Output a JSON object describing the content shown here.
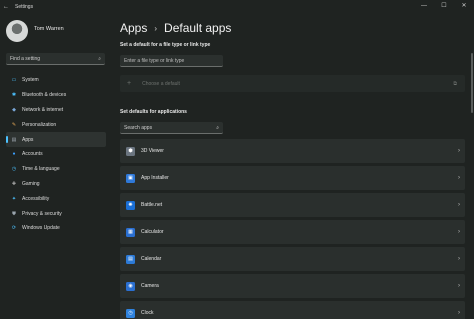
{
  "window": {
    "title": "Settings",
    "back_glyph": "←",
    "controls": {
      "minimize": "—",
      "maximize": "☐",
      "close": "✕"
    }
  },
  "sidebar": {
    "user_name": "Tom Warren",
    "find_placeholder": "Find a setting",
    "items": [
      {
        "label": "System",
        "icon": "display-icon",
        "glyph": "▭",
        "color": "#4cc2ff"
      },
      {
        "label": "Bluetooth & devices",
        "icon": "bluetooth-icon",
        "glyph": "✱",
        "color": "#4cc2ff"
      },
      {
        "label": "Network & internet",
        "icon": "network-icon",
        "glyph": "◆",
        "color": "#7aa7d8"
      },
      {
        "label": "Personalization",
        "icon": "brush-icon",
        "glyph": "✎",
        "color": "#e3a857"
      },
      {
        "label": "Apps",
        "icon": "apps-icon",
        "glyph": "▤",
        "color": "#9aa4ad",
        "active": true
      },
      {
        "label": "Accounts",
        "icon": "person-icon",
        "glyph": "●",
        "color": "#3aa0ff"
      },
      {
        "label": "Time & language",
        "icon": "clock-globe-icon",
        "glyph": "◷",
        "color": "#4cc2ff"
      },
      {
        "label": "Gaming",
        "icon": "gamepad-icon",
        "glyph": "✚",
        "color": "#b7b7b7"
      },
      {
        "label": "Accessibility",
        "icon": "accessibility-icon",
        "glyph": "✦",
        "color": "#4cc2ff"
      },
      {
        "label": "Privacy & security",
        "icon": "shield-icon",
        "glyph": "⛊",
        "color": "#9aa4ad"
      },
      {
        "label": "Windows Update",
        "icon": "update-icon",
        "glyph": "⟳",
        "color": "#4cc2ff"
      }
    ]
  },
  "main": {
    "breadcrumb": {
      "parent": "Apps",
      "separator": "›",
      "current": "Default apps"
    },
    "filetype_heading": "Set a default for a file type or link type",
    "filetype_placeholder": "Enter a file type or link type",
    "choose_default": {
      "plus": "+",
      "label": "Choose a default",
      "ext": "⧉"
    },
    "apps_heading": "Set defaults for applications",
    "search_apps_placeholder": "Search apps",
    "chevron": "›",
    "apps": [
      {
        "name": "3D Viewer",
        "icon": "cube-icon",
        "glyph": "⬢",
        "color": "#6b7580"
      },
      {
        "name": "App Installer",
        "icon": "package-icon",
        "glyph": "▣",
        "color": "#2f79d9"
      },
      {
        "name": "Battle.net",
        "icon": "battlenet-icon",
        "glyph": "✺",
        "color": "#1a6fd6"
      },
      {
        "name": "Calculator",
        "icon": "calculator-icon",
        "glyph": "▦",
        "color": "#2a6fd1"
      },
      {
        "name": "Calendar",
        "icon": "calendar-icon",
        "glyph": "▤",
        "color": "#2c7ad6"
      },
      {
        "name": "Camera",
        "icon": "camera-icon",
        "glyph": "◉",
        "color": "#2a6fd1"
      },
      {
        "name": "Clock",
        "icon": "clock-icon",
        "glyph": "◷",
        "color": "#2e82de"
      }
    ]
  }
}
